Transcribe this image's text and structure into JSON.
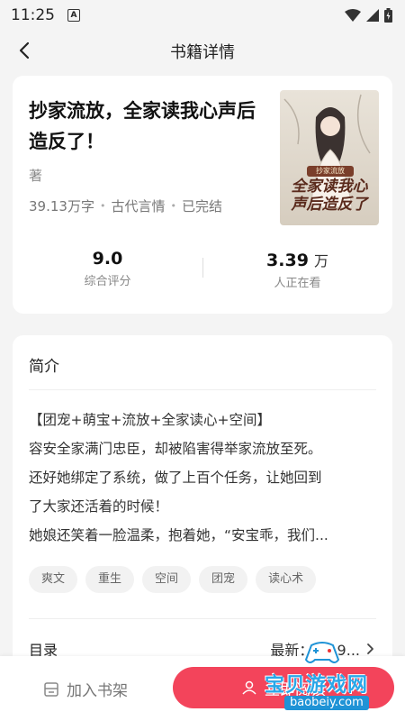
{
  "status_bar": {
    "time": "11:25",
    "notif_icon": "A"
  },
  "header": {
    "title": "书籍详情"
  },
  "book": {
    "title": "抄家流放，全家读我心声后造反了！",
    "author_label": "著",
    "word_count": "39.13万字",
    "genre": "古代言情",
    "status": "已完结",
    "cover": {
      "badge": "抄家流放",
      "line1": "全家读我心",
      "line2": "声后造反了"
    },
    "rating": {
      "value": "9.0",
      "label": "综合评分"
    },
    "readers": {
      "value": "3.39",
      "unit": "万",
      "label": "人正在看"
    }
  },
  "intro": {
    "title": "简介",
    "lines": [
      "【团宠+萌宝+流放+全家读心+空间】",
      "容安全家满门忠臣，却被陷害得举家流放至死。",
      "还好她绑定了系统，做了上百个任务，让她回到",
      "了大家还活着的时候！",
      "她娘还笑着一脸温柔，抱着她，“安宝乖，我们..."
    ],
    "tags": [
      "爽文",
      "重生",
      "空间",
      "团宠",
      "读心术"
    ]
  },
  "catalog": {
    "label": "目录",
    "latest": "最新：第19..."
  },
  "bottom": {
    "shelf_label": "加入书架",
    "read_label": "立即阅读"
  },
  "watermark": {
    "text": "宝贝游戏网",
    "url": "baobeiy.com"
  },
  "colors": {
    "accent": "#f3445b",
    "background": "#f4f4f4"
  }
}
